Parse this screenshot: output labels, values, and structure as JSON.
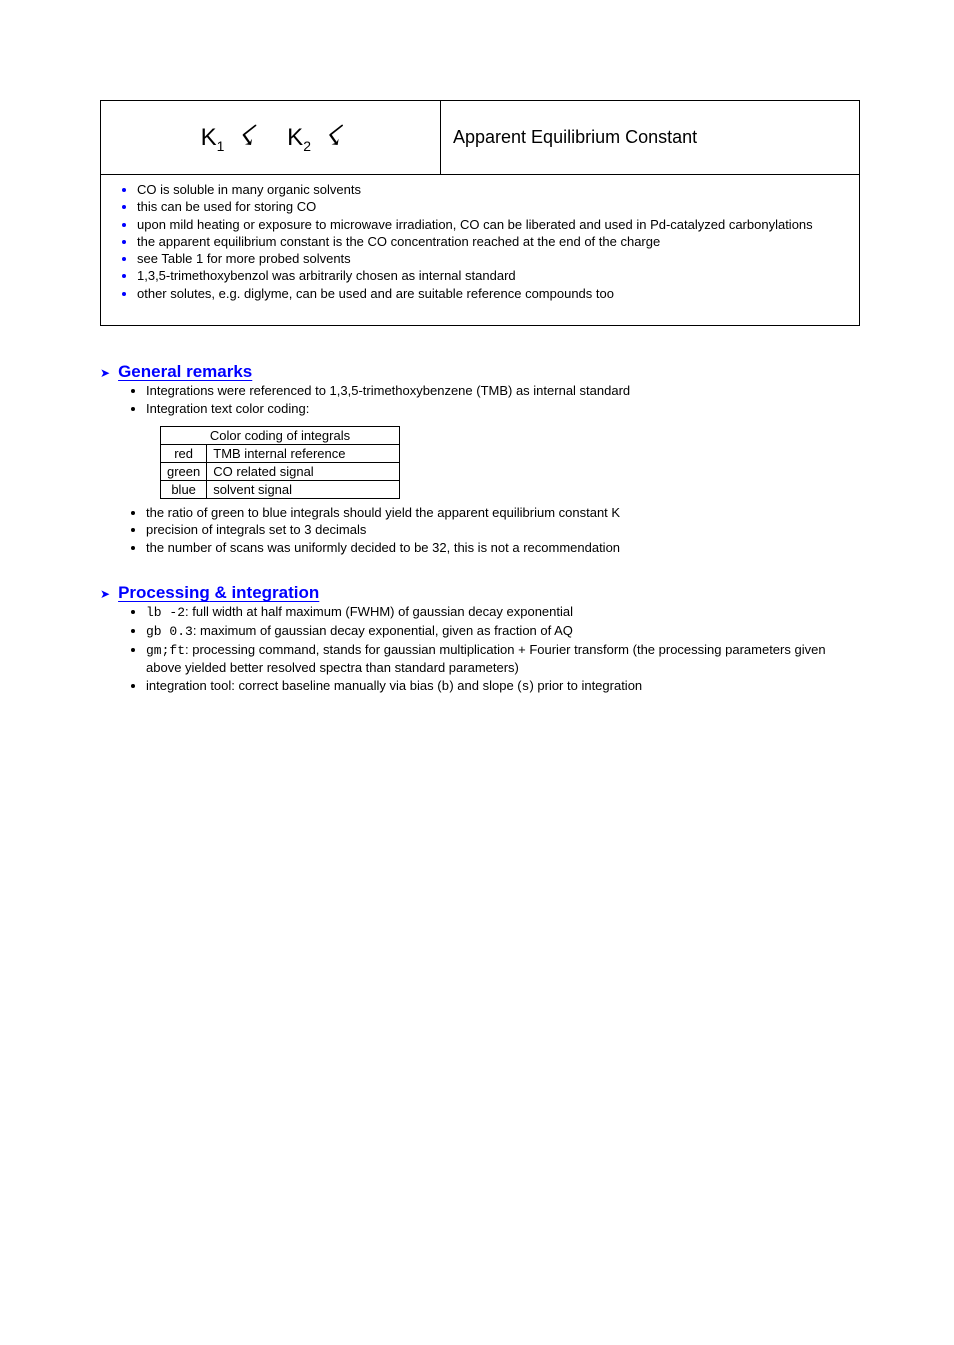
{
  "panel": {
    "k1_pre": "K",
    "k1_sub": "1",
    "k2_pre": "K",
    "k2_sub": "2",
    "right_label": "Apparent Equilibrium Constant",
    "bullets": [
      "CO is soluble in many organic solvents",
      "this can be used for storing CO",
      "upon mild heating or exposure to microwave irradiation, CO can  be liberated and used in Pd-catalyzed carbonylations",
      "the apparent equilibrium constant is the CO concentration reached at the end of the charge",
      "see Table 1 for more probed solvents",
      "1,3,5-trimethoxybenzol was arbitrarily chosen as internal standard",
      "other solutes, e.g. diglyme, can be used and are suitable reference compounds too"
    ]
  },
  "sec1": {
    "title": "General remarks",
    "items": [
      "Integrations were referenced to 1,3,5-trimethoxybenzene (TMB) as internal standard",
      "Integration text color coding:"
    ],
    "table": {
      "header": "Color coding of integrals",
      "rows": [
        [
          "red",
          "TMB internal reference"
        ],
        [
          "green",
          "CO related signal"
        ],
        [
          "blue",
          "solvent signal"
        ]
      ]
    },
    "items2": [
      "the ratio of green to blue integrals should yield the apparent equilibrium constant K",
      "precision of integrals set to 3 decimals",
      "the number of scans was uniformly decided to be 32, this is not a recommendation"
    ]
  },
  "sec2": {
    "title_a": "Processing",
    "title_b": " & integration",
    "items": [
      {
        "pre": "",
        "code": "lb -2",
        "post": ": full width at half maximum (FWHM) of gaussian decay exponential"
      },
      {
        "pre": "",
        "code": "gb 0.3",
        "post": ": maximum of gaussian decay exponential, given as fraction of AQ"
      },
      {
        "pre": "",
        "code": "gm;ft",
        "post": ": processing command, stands for gaussian multiplication + Fourier transform (the processing parameters given above yielded better resolved spectra than standard parameters)"
      },
      {
        "pre": "integration tool: correct baseline manually via bias (",
        "code": "b",
        "post": ") and slope (",
        "code2": "s",
        "post2": ") prior to integration"
      }
    ]
  }
}
